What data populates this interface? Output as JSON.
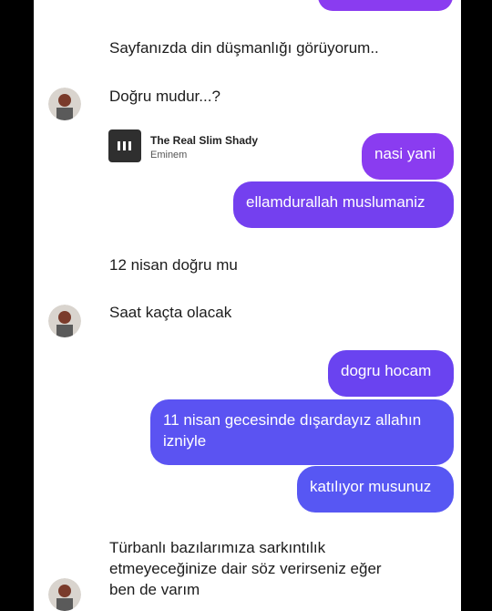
{
  "messages": {
    "m1": "Sayfanızda din düşmanlığı görüyorum..",
    "m2": "Doğru mudur...?",
    "music": {
      "title": "The Real Slim Shady",
      "artist": "Eminem"
    },
    "m3": "nasi yani",
    "m4": "ellamdurallah muslumaniz",
    "m5": "12 nisan doğru mu",
    "m6": "Saat kaçta olacak",
    "m7": "dogru hocam",
    "m8": "11 nisan gecesinde dışardayız allahın izniyle",
    "m9": "katılıyor musunuz",
    "m10": "Türbanlı bazılarımıza sarkıntılık etmeyeceğinize dair söz verirseniz eğer ben de varım"
  },
  "colors": {
    "purple": "#8a3cf0",
    "violet": "#6a43f0",
    "blue": "#5a55f2"
  }
}
